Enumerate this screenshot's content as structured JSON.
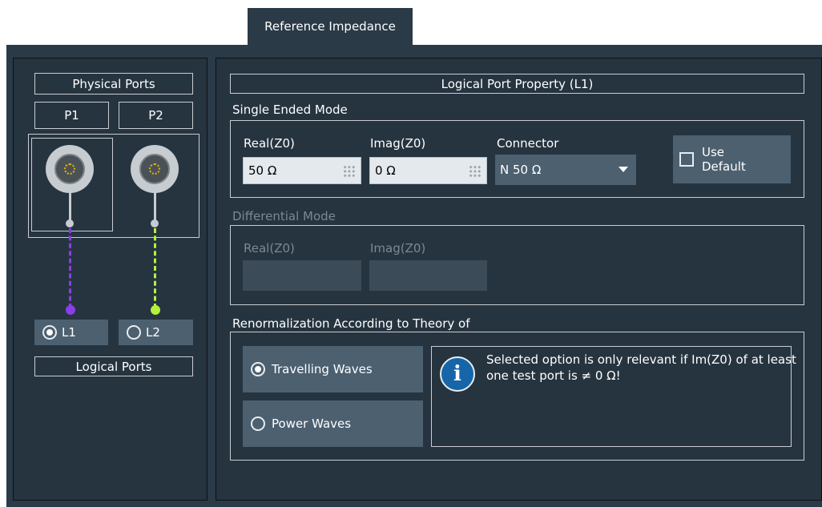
{
  "tab": {
    "label": "Reference Impedance"
  },
  "left": {
    "physical_ports_title": "Physical Ports",
    "ports": [
      "P1",
      "P2"
    ],
    "logical_ports": [
      {
        "label": "L1",
        "selected": true,
        "line_color": "#8a3ee6"
      },
      {
        "label": "L2",
        "selected": false,
        "line_color": "#b6f03a"
      }
    ],
    "logical_ports_title": "Logical Ports"
  },
  "right": {
    "property_title": "Logical Port Property (L1)",
    "single_ended": {
      "title": "Single Ended Mode",
      "real_label": "Real(Z0)",
      "real_value": "50 Ω",
      "imag_label": "Imag(Z0)",
      "imag_value": "0 Ω",
      "connector_label": "Connector",
      "connector_value": "N 50 Ω",
      "use_default_label_line1": "Use",
      "use_default_label_line2": "Default",
      "use_default_checked": false
    },
    "differential": {
      "title": "Differential Mode",
      "real_label": "Real(Z0)",
      "imag_label": "Imag(Z0)"
    },
    "renormalization": {
      "title": "Renormalization According to Theory of",
      "options": [
        {
          "label": "Travelling Waves",
          "selected": true
        },
        {
          "label": "Power Waves",
          "selected": false
        }
      ],
      "info_icon": "info-icon",
      "info_text": "Selected option is only relevant if Im(Z0) of at least one test port is ≠ 0 Ω!"
    }
  },
  "colors": {
    "background": "#2a3a47",
    "panel": "#263440",
    "button": "#4c6070",
    "info_blue": "#1565a8"
  }
}
